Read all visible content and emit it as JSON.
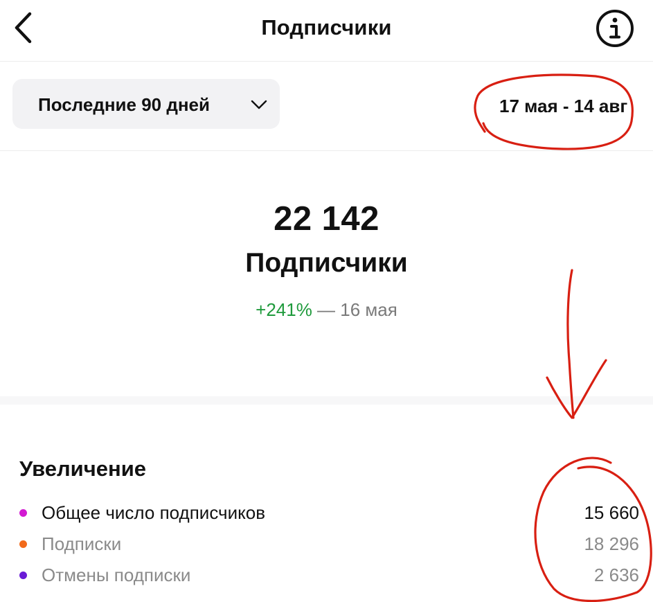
{
  "header": {
    "title": "Подписчики"
  },
  "filter": {
    "period_label": "Последние 90 дней",
    "date_range": "17 мая - 14 авг"
  },
  "summary": {
    "total": "22 142",
    "label": "Подписчики",
    "change": "+241%",
    "change_suffix": " — 16 мая"
  },
  "growth": {
    "title": "Увеличение",
    "rows": [
      {
        "label": "Общее число подписчиков",
        "value": "15 660",
        "dot_color": "#d21bd2"
      },
      {
        "label": "Подписки",
        "value": "18 296",
        "dot_color": "#f26a1b"
      },
      {
        "label": "Отмены подписки",
        "value": "2 636",
        "dot_color": "#6a1bd6"
      }
    ]
  },
  "colors": {
    "positive": "#1f9a3c",
    "annotation": "#d81f12",
    "muted_text": "#8a8a8a"
  },
  "icons": {
    "back": "chevron-left-icon",
    "info": "info-icon",
    "dropdown": "chevron-down-icon"
  }
}
